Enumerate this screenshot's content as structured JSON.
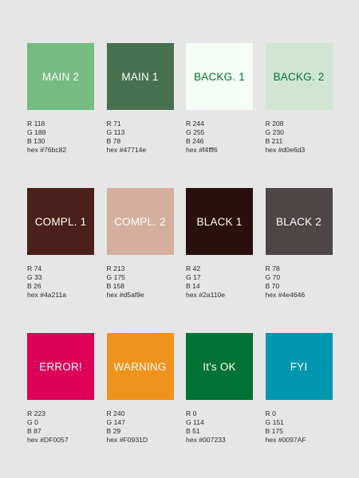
{
  "swatches": [
    {
      "label": "MAIN 2",
      "color": "#76bc82",
      "text_color": "#ffffff",
      "r": "R 118",
      "g": "G 188",
      "b": "B 130",
      "hex": "hex #76bc82"
    },
    {
      "label": "MAIN 1",
      "color": "#47714e",
      "text_color": "#ffffff",
      "r": "R 71",
      "g": "G 113",
      "b": "B 78",
      "hex": "hex #47714e"
    },
    {
      "label": "BACKG. 1",
      "color": "#f4fff6",
      "text_color": "#007233",
      "r": "R 244",
      "g": "G 255",
      "b": "B 246",
      "hex": "hex #f4fff6"
    },
    {
      "label": "BACKG. 2",
      "color": "#d0e6d3",
      "text_color": "#007233",
      "r": "R 208",
      "g": "G 230",
      "b": "B 211",
      "hex": "hex #d0e6d3"
    },
    {
      "label": "COMPL. 1",
      "color": "#4a211a",
      "text_color": "#ffffff",
      "r": "R 74",
      "g": "G 33",
      "b": "B 26",
      "hex": "hex #4a211a"
    },
    {
      "label": "COMPL. 2",
      "color": "#d5af9e",
      "text_color": "#ffffff",
      "r": "R 213",
      "g": "G 175",
      "b": "B 158",
      "hex": "hex #d5af9e"
    },
    {
      "label": "BLACK 1",
      "color": "#2a110e",
      "text_color": "#ffffff",
      "r": "R 42",
      "g": "G 17",
      "b": "B 14",
      "hex": "hex #2a110e"
    },
    {
      "label": "BLACK 2",
      "color": "#4e4646",
      "text_color": "#ffffff",
      "r": "R 78",
      "g": "G 70",
      "b": "B 70",
      "hex": "hex #4e4646"
    },
    {
      "label": "ERROR!",
      "color": "#DF0057",
      "text_color": "#ffffff",
      "r": "R 223",
      "g": "G 0",
      "b": "B 87",
      "hex": "hex #DF0057"
    },
    {
      "label": "WARNING",
      "color": "#F0931D",
      "text_color": "#ffffff",
      "r": "R 240",
      "g": "G 147",
      "b": "B 29",
      "hex": "hex #F0931D"
    },
    {
      "label": "It's OK",
      "color": "#007233",
      "text_color": "#ffffff",
      "r": "R 0",
      "g": "G 114",
      "b": "B 51",
      "hex": "hex #007233"
    },
    {
      "label": "FYI",
      "color": "#0097AF",
      "text_color": "#ffffff",
      "r": "R 0",
      "g": "G 151",
      "b": "B 175",
      "hex": "hex #0097AF"
    }
  ]
}
